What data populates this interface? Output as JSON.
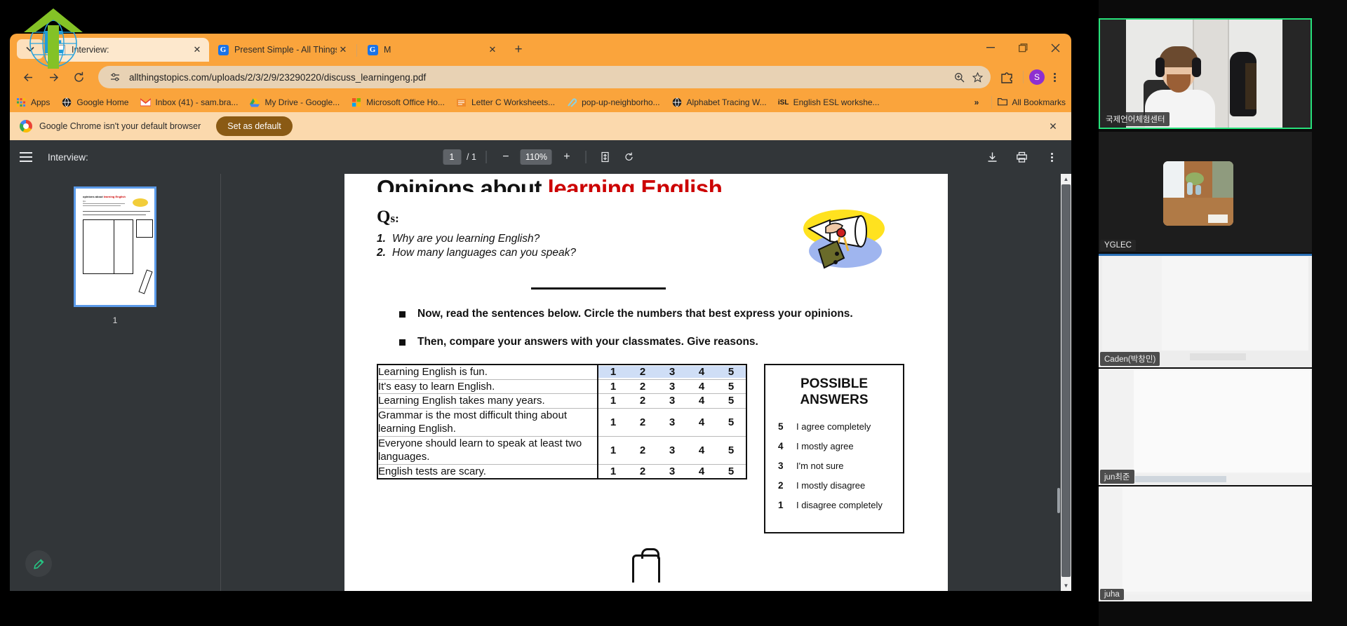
{
  "browser": {
    "tabs": [
      {
        "title": "Interview:",
        "favicon": "page-icon",
        "active": true
      },
      {
        "title": "Present Simple - All Things Gra",
        "favicon": "google-docs-icon",
        "active": false
      },
      {
        "title": "M",
        "favicon": "google-docs-icon",
        "active": false
      }
    ],
    "new_tab_label": "+",
    "window_controls": {
      "minimize": "—",
      "maximize": "❐",
      "close": "✕"
    },
    "nav": {
      "back": "←",
      "forward": "→",
      "reload": "⟳"
    },
    "omnibox": {
      "url": "allthingstopics.com/uploads/2/3/2/9/23290220/discuss_learningeng.pdf",
      "site_info_icon": "tune-icon",
      "zoom_icon": "search-plus-icon",
      "bookmark_icon": "star-icon"
    },
    "extensions_icon": "puzzle-icon",
    "profile_initial": "S",
    "menu_icon": "kebab-menu-icon",
    "bookmarks": [
      {
        "label": "Apps",
        "icon": "apps-grid-icon"
      },
      {
        "label": "Google Home",
        "icon": "globe-icon"
      },
      {
        "label": "Inbox (41) - sam.bra...",
        "icon": "gmail-icon"
      },
      {
        "label": "My Drive - Google...",
        "icon": "drive-icon"
      },
      {
        "label": "Microsoft Office Ho...",
        "icon": "office-icon"
      },
      {
        "label": "Letter C Worksheets...",
        "icon": "doc-icon"
      },
      {
        "label": "pop-up-neighborho...",
        "icon": "clip-icon"
      },
      {
        "label": "Alphabet Tracing W...",
        "icon": "globe-icon"
      },
      {
        "label": "English ESL workshe...",
        "icon": "isl-icon"
      }
    ],
    "bookmarks_overflow": "»",
    "all_bookmarks_label": "All Bookmarks",
    "infobar": {
      "message": "Google Chrome isn't your default browser",
      "button": "Set as default",
      "close": "✕"
    }
  },
  "pdf_viewer": {
    "sidebar_toggle_icon": "hamburger-icon",
    "document_title": "Interview:",
    "page_current": "1",
    "page_total": "/ 1",
    "zoom_out": "−",
    "zoom_level": "110%",
    "zoom_in": "+",
    "fit_icon": "fit-page-icon",
    "rotate_icon": "rotate-icon",
    "download_icon": "download-icon",
    "print_icon": "print-icon",
    "more_icon": "kebab-menu-icon",
    "thumbnail_number": "1",
    "annotate_icon": "pencil-icon"
  },
  "document": {
    "title_plain": "Opinions about ",
    "title_red": "learning English",
    "qs_label": "Q",
    "qs_label_sub": "s:",
    "questions": [
      {
        "num": "1.",
        "text": "Why are you learning English?"
      },
      {
        "num": "2.",
        "text": "How many languages can you speak?"
      }
    ],
    "bullets": [
      "Now, read the sentences below.  Circle the numbers that best express your opinions.",
      "Then, compare your answers with your classmates.  Give reasons."
    ],
    "scale": [
      "1",
      "2",
      "3",
      "4",
      "5"
    ],
    "statements": [
      "Learning English is fun.",
      "It's easy to learn English.",
      "Learning English takes many years.",
      "Grammar is the most difficult thing about learning English.",
      "Everyone should learn to speak at least two languages.",
      "English tests are scary."
    ],
    "selected_row_index": 0,
    "answers_box": {
      "heading_line1": "POSSIBLE",
      "heading_line2": "ANSWERS",
      "items": [
        {
          "num": "5",
          "text": "I agree completely"
        },
        {
          "num": "4",
          "text": "I mostly agree"
        },
        {
          "num": "3",
          "text": "I'm not sure"
        },
        {
          "num": "2",
          "text": "I mostly disagree"
        },
        {
          "num": "1",
          "text": "I disagree completely"
        }
      ]
    }
  },
  "video_panel": {
    "accent_active": "#27e07a",
    "participants": [
      {
        "name": "국제언어체험센터",
        "active": true
      },
      {
        "name": "YGLEC",
        "active": false
      },
      {
        "name": "Caden(박창민)",
        "active": false
      },
      {
        "name": "jun최준",
        "active": false
      },
      {
        "name": "juha",
        "active": false
      }
    ]
  }
}
